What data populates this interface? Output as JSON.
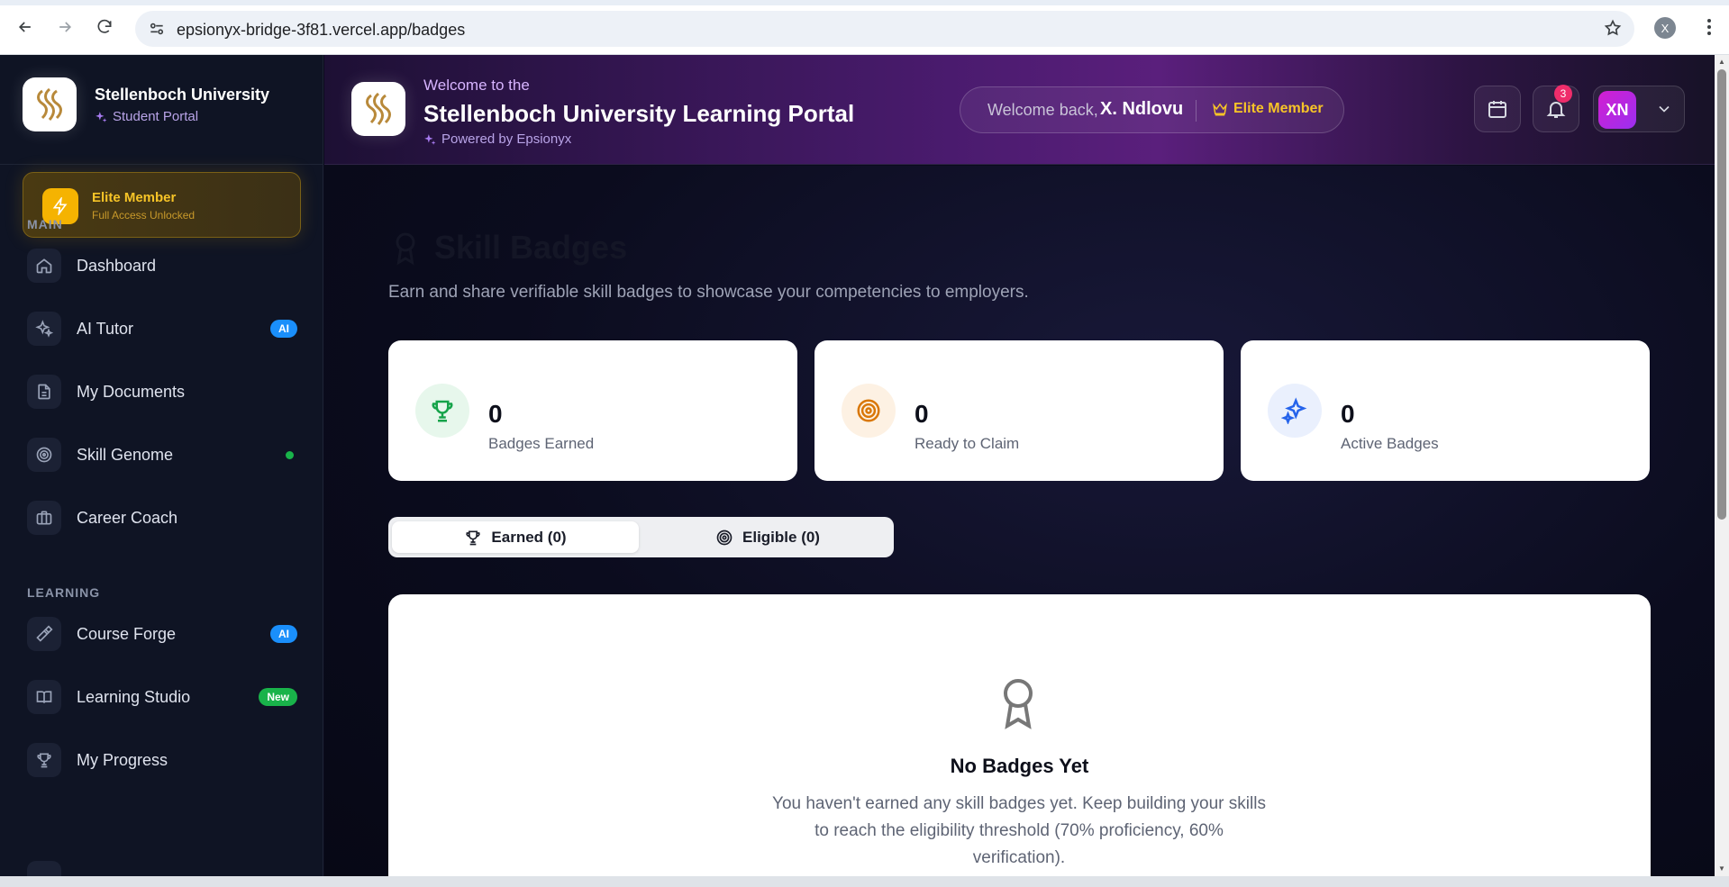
{
  "browser": {
    "url": "epsionyx-bridge-3f81.vercel.app/badges",
    "profile_initial": "X"
  },
  "sidebar": {
    "brand_title": "Stellenboch University",
    "brand_subtitle": "Student Portal",
    "elite": {
      "title": "Elite Member",
      "subtitle": "Full Access Unlocked"
    },
    "sections": [
      {
        "label": "MAIN"
      },
      {
        "label": "LEARNING"
      }
    ],
    "items": [
      {
        "label": "Dashboard",
        "icon": "home-icon"
      },
      {
        "label": "AI Tutor",
        "icon": "sparkles-icon",
        "badge": "AI"
      },
      {
        "label": "My Documents",
        "icon": "document-icon"
      },
      {
        "label": "Skill Genome",
        "icon": "target-icon",
        "status": "online-dot"
      },
      {
        "label": "Career Coach",
        "icon": "briefcase-icon"
      },
      {
        "label": "Course Forge",
        "icon": "hammer-icon",
        "badge": "AI"
      },
      {
        "label": "Learning Studio",
        "icon": "book-open-icon",
        "badge": "New"
      },
      {
        "label": "My Progress",
        "icon": "trophy-icon"
      }
    ]
  },
  "header": {
    "welcome_to": "Welcome to the",
    "portal_title": "Stellenboch University Learning Portal",
    "powered_by": "Powered by Epsionyx",
    "welcome_back": "Welcome back,",
    "user_name": "X. Ndlovu",
    "member_label": "Elite Member",
    "notification_count": "3",
    "avatar_initials": "XN"
  },
  "main": {
    "title": "Skill Badges",
    "subtitle": "Earn and share verifiable skill badges to showcase your competencies to employers.",
    "stats": [
      {
        "value": "0",
        "label": "Badges Earned",
        "icon": "trophy-icon",
        "color": "#16a34a",
        "bg": "#e7f7ec"
      },
      {
        "value": "0",
        "label": "Ready to Claim",
        "icon": "target-icon",
        "color": "#d97706",
        "bg": "#fdf1e3"
      },
      {
        "value": "0",
        "label": "Active Badges",
        "icon": "sparkles-icon",
        "color": "#2563eb",
        "bg": "#eaf0fd"
      }
    ],
    "tabs": [
      {
        "label": "Earned (0)",
        "icon": "trophy-icon",
        "active": true
      },
      {
        "label": "Eligible (0)",
        "icon": "target-icon",
        "active": false
      }
    ],
    "empty_state": {
      "title": "No Badges Yet",
      "text": "You haven't earned any skill badges yet. Keep building your skills to reach the eligibility threshold (70% proficiency, 60% verification)."
    }
  },
  "colors": {
    "sidebar_bg": "#0f1424",
    "header_accent": "#5a1f7c",
    "elite_gold": "#f7c427",
    "badge_ai": "#1a8ffb",
    "badge_new": "#19b34a",
    "notification": "#ef2d6b"
  }
}
